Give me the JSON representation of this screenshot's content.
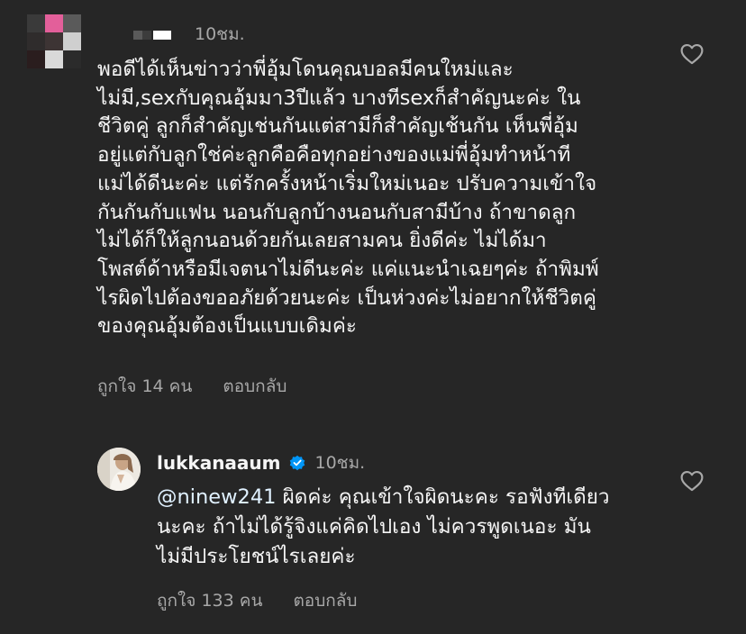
{
  "colors": {
    "background": "#262626",
    "text_primary": "#f5f5f5",
    "text_secondary": "#a8a8a8",
    "verified_badge": "#0095f6",
    "mention": "#e0f1ff"
  },
  "comment": {
    "avatar_icon": "pixelated-avatar",
    "username_icon": "redacted-name",
    "time": "10ชม.",
    "lines": [
      "พอดีได้เห็นข่าวว่าพี่อุ้มโดนคุณบอลมีคนใหม่และ",
      "ไม่มี,sexกับคุณอุ้มมา3ปีแล้ว บางทีsexก็สำคัญนะค่ะ ใน",
      "ชีวิตคู่ ลูกก็สำคัญเช่นกันแต่สามีก็สำคัญเช้นกัน เห็นพี่อุ้ม",
      "อยู่แต่กับลูกใช่ค่ะลูกคือคือทุกอย่างของแม่พี่อุ้มทำหน้าที",
      "แม่ได้ดีนะค่ะ แต่รักครั้งหน้าเริ่มใหม่เนอะ ปรับความเข้าใจ",
      "กันกันกับแฟน นอนกับลูกบ้างนอนกับสามีบ้าง ถ้าขาดลูก",
      "ไม่ได้ก็ให้ลูกนอนด้วยกันเลยสามคน ยิ่งดีค่ะ ไม่ได้มา",
      "โพสต์ด้าหรือมีเจตนาไม่ดีนะค่ะ แค่แนะนำเฉยๆค่ะ ถ้าพิมพ์",
      "ไรผิดไปต้องขออภัยด้วยนะค่ะ เป็นห่วงค่ะไม่อยากให้ชีวิตคู่",
      "ของคุณอุ้มต้องเป็นแบบเดิมค่ะ"
    ],
    "likes": "ถูกใจ 14 คน",
    "reply_label": "ตอบกลับ",
    "like_icon": "heart-outline-icon"
  },
  "reply": {
    "avatar_icon": "profile-avatar",
    "username": "lukkanaaum",
    "verified_icon": "verified-badge-icon",
    "time": "10ชม.",
    "mention": "@ninew241",
    "first_line_rest": " ผิดค่ะ คุณเข้าใจผิดนะคะ รอฟังทีเดียว",
    "lines": [
      "นะคะ ถ้าไม่ได้รู้จิงแค่คิดไปเอง ไม่ควรพูดเนอะ มัน",
      "ไม่มีประโยชน์ไรเลยค่ะ"
    ],
    "likes": "ถูกใจ 133 คน",
    "reply_label": "ตอบกลับ",
    "like_icon": "heart-outline-icon"
  }
}
